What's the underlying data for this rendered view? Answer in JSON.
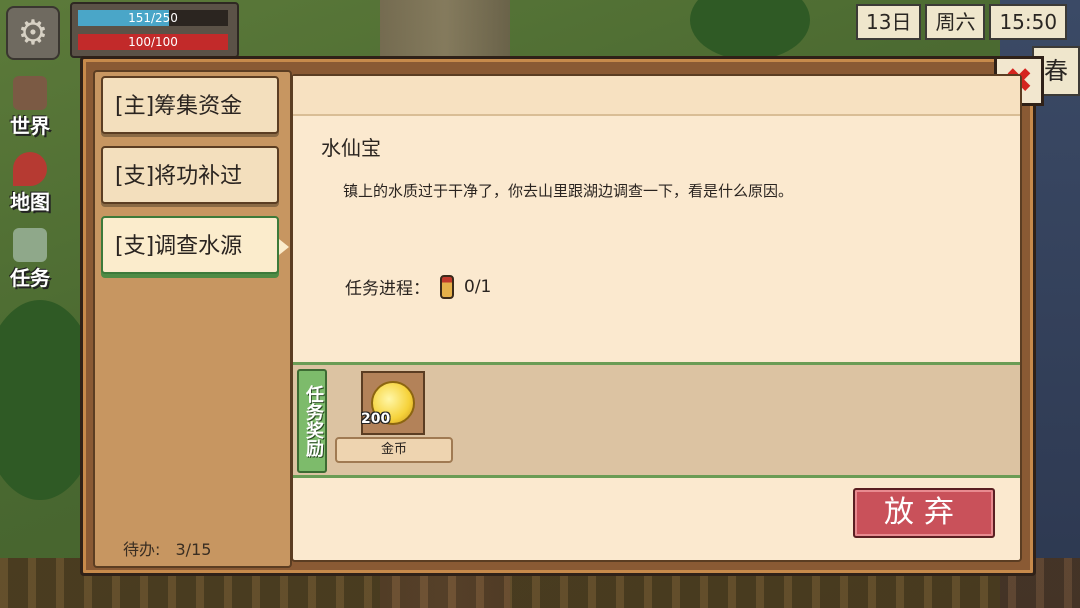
{
  "hud": {
    "hp_text": "151/250",
    "hp_fraction": 0.604,
    "mp_text": "100/100",
    "mp_fraction": 1.0,
    "day": "13日",
    "weekday": "周六",
    "time": "15:50",
    "season": "春"
  },
  "left_nav": {
    "items": [
      {
        "label": "世界",
        "icon": "people-icon"
      },
      {
        "label": "地图",
        "icon": "map-pin-icon"
      },
      {
        "label": "任务",
        "icon": "scroll-icon"
      }
    ]
  },
  "quest_list": {
    "tabs": [
      {
        "label": "[主]筹集资金",
        "active": false
      },
      {
        "label": "[支]将功补过",
        "active": false
      },
      {
        "label": "[支]调查水源",
        "active": true
      }
    ],
    "todo_label": "待办:",
    "todo_count": "3/15"
  },
  "quest_detail": {
    "title": "水仙宝",
    "description": "镇上的水质过于干净了，你去山里跟湖边调查一下，看是什么原因。",
    "progress_label": "任务进程：",
    "progress_value": "0/1",
    "progress_icon": "bottle-icon"
  },
  "rewards": {
    "tag": "任务奖励",
    "items": [
      {
        "name": "金币",
        "count": "200",
        "icon": "gold-coin-icon"
      }
    ]
  },
  "buttons": {
    "abandon": "放弃",
    "close_icon": "close-icon"
  },
  "colors": {
    "accent_green": "#6a9c55",
    "abandon_red": "#c9515a",
    "close_red": "#d5241f"
  }
}
